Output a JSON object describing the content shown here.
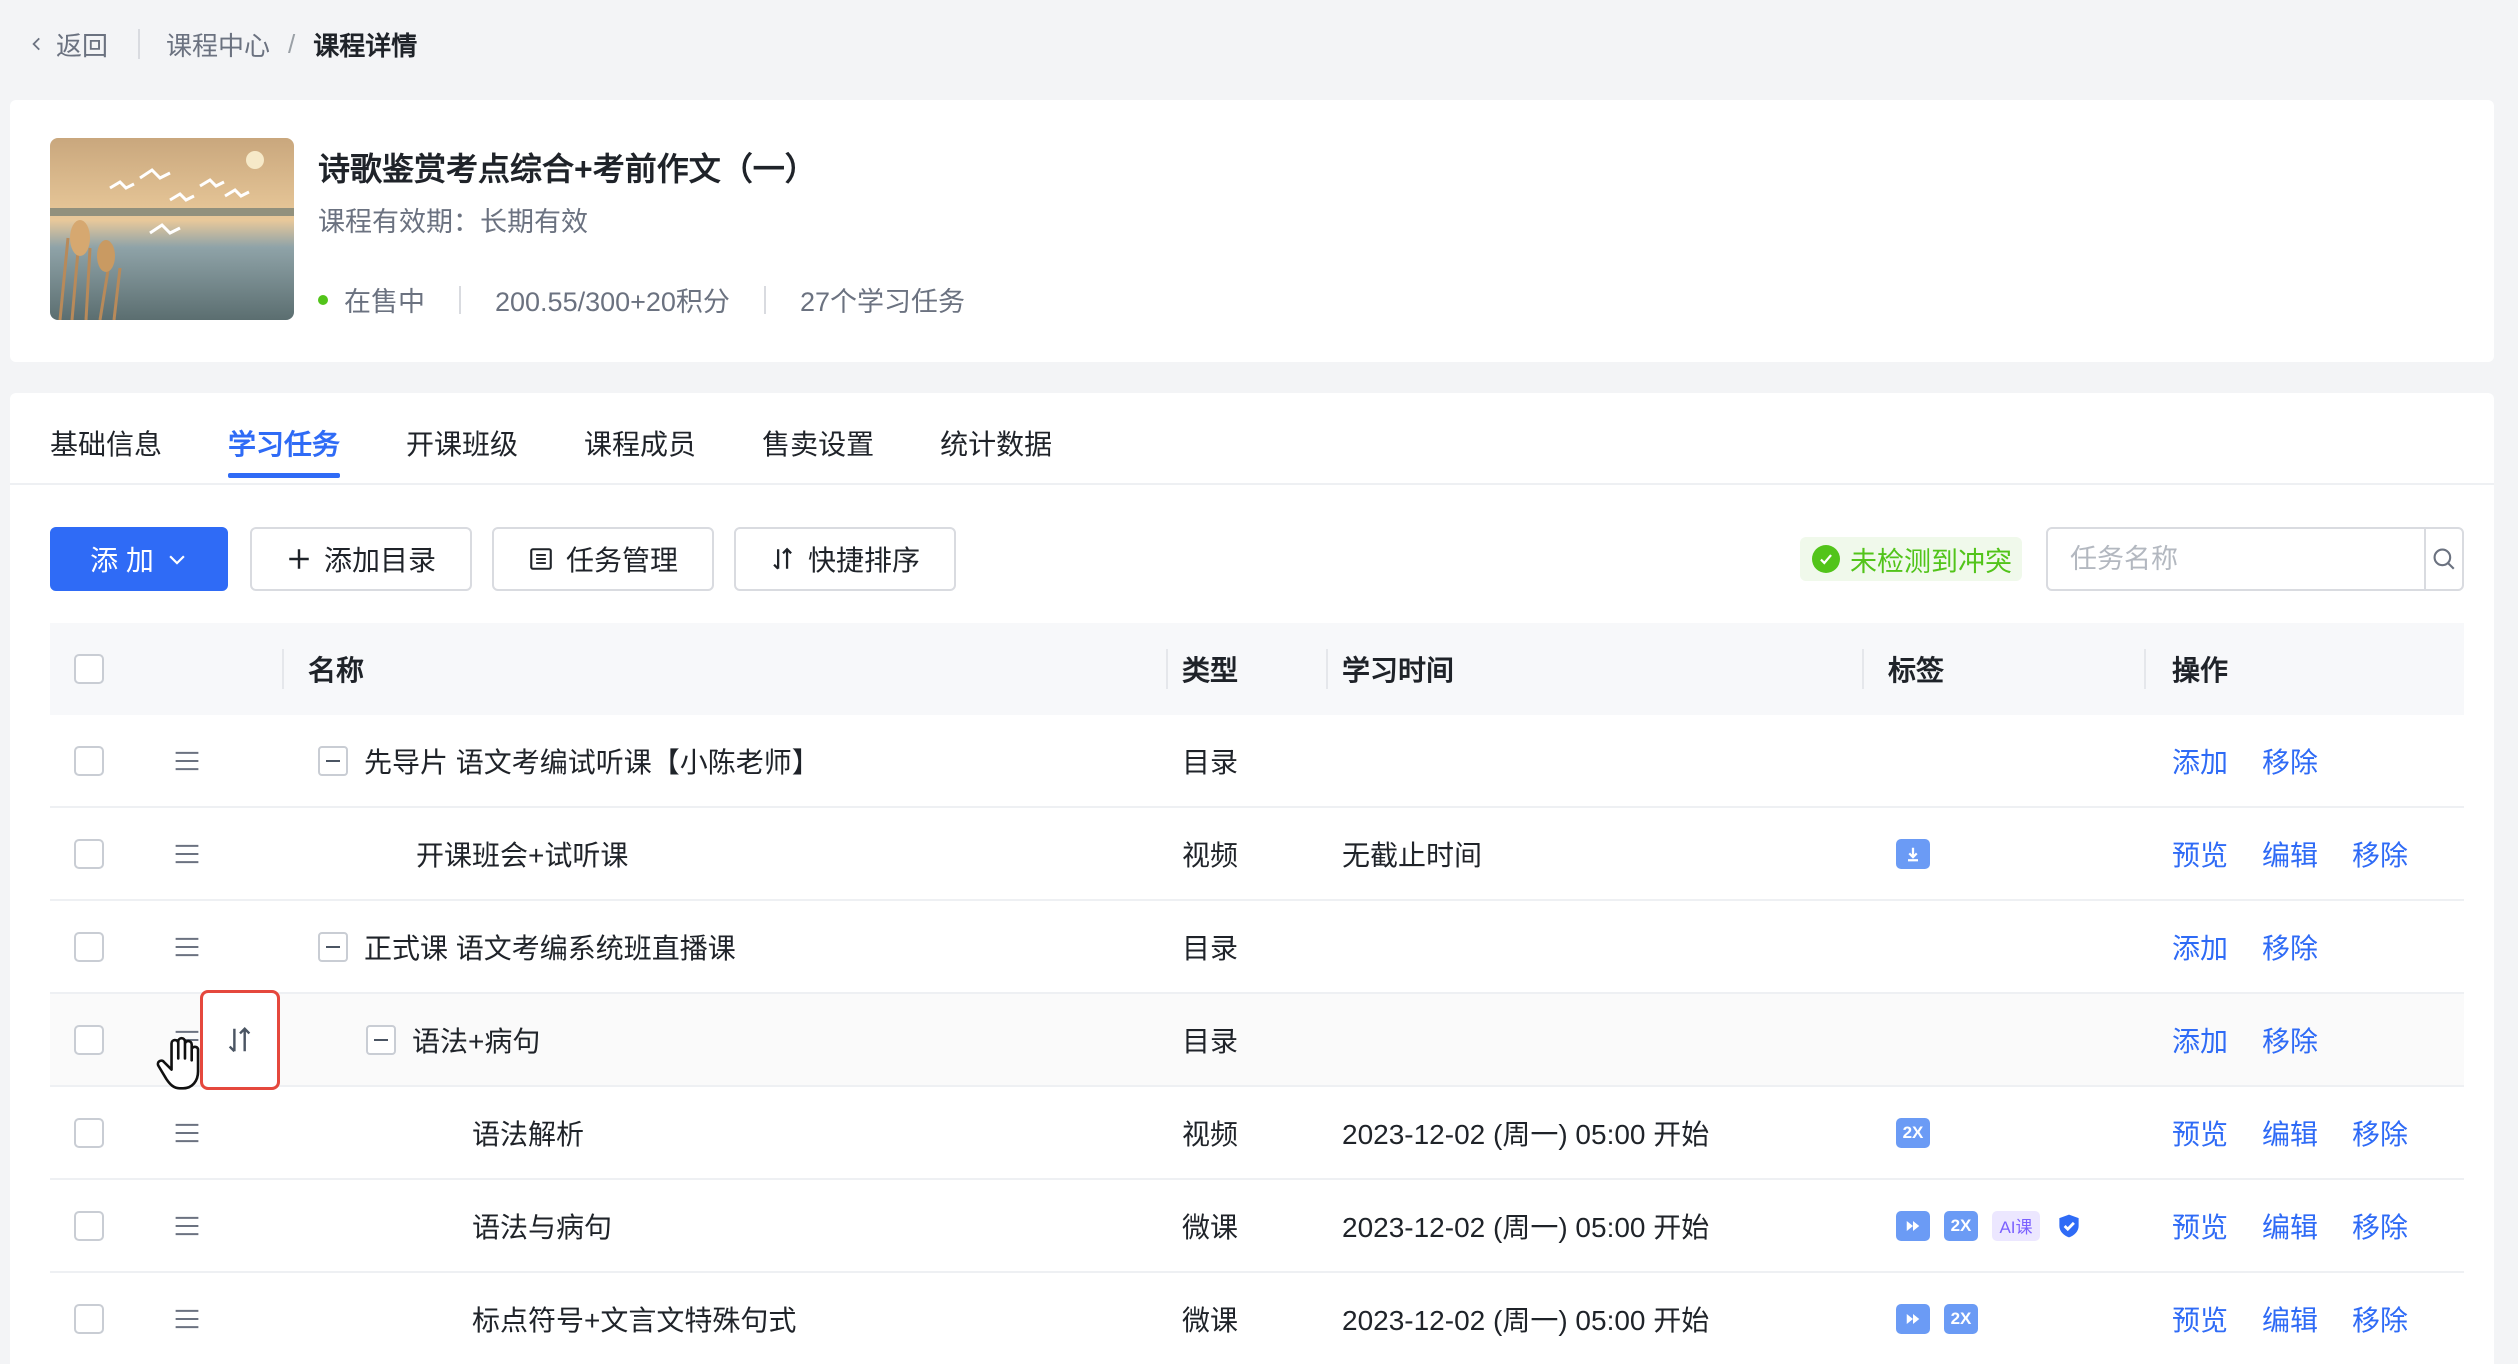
{
  "breadcrumb": {
    "back": "返回",
    "parent": "课程中心",
    "separator": "/",
    "current": "课程详情"
  },
  "course": {
    "title": "诗歌鉴赏考点综合+考前作文（一）",
    "validity": "课程有效期：长期有效",
    "status": "在售中",
    "price": "200.55/300+20积分",
    "tasks": "27个学习任务",
    "status_color": "#52c41a"
  },
  "tabs": [
    {
      "label": "基础信息"
    },
    {
      "label": "学习任务"
    },
    {
      "label": "开课班级"
    },
    {
      "label": "课程成员"
    },
    {
      "label": "售卖设置"
    },
    {
      "label": "统计数据"
    }
  ],
  "toolbar": {
    "add": "添 加",
    "add_dir": "添加目录",
    "task_manage": "任务管理",
    "quick_sort": "快捷排序",
    "conflict": "未检测到冲突",
    "search_placeholder": "任务名称"
  },
  "table": {
    "headers": {
      "name": "名称",
      "type": "类型",
      "time": "学习时间",
      "tags": "标签",
      "ops": "操作"
    },
    "rows": [
      {
        "name": "先导片 语文考编试听课【小陈老师】",
        "type": "目录",
        "time": "",
        "ops": [
          "添加",
          "移除"
        ]
      },
      {
        "name": "开课班会+试听课",
        "type": "视频",
        "time": "无截止时间",
        "ops": [
          "预览",
          "编辑",
          "移除"
        ]
      },
      {
        "name": "正式课 语文考编系统班直播课",
        "type": "目录",
        "time": "",
        "ops": [
          "添加",
          "移除"
        ]
      },
      {
        "name": "语法+病句",
        "type": "目录",
        "time": "",
        "ops": [
          "添加",
          "移除"
        ]
      },
      {
        "name": "语法解析",
        "type": "视频",
        "time": "2023-12-02 (周一) 05:00 开始",
        "ops": [
          "预览",
          "编辑",
          "移除"
        ]
      },
      {
        "name": "语法与病句",
        "type": "微课",
        "time": "2023-12-02 (周一) 05:00 开始",
        "ops": [
          "预览",
          "编辑",
          "移除"
        ]
      },
      {
        "name": "标点符号+文言文特殊句式",
        "type": "微课",
        "time": "2023-12-02 (周一) 05:00 开始",
        "ops": [
          "预览",
          "编辑",
          "移除"
        ]
      }
    ]
  },
  "tag_labels": {
    "speed": "2X",
    "ai": "AI课"
  },
  "accent_color": "#2f6bf6"
}
